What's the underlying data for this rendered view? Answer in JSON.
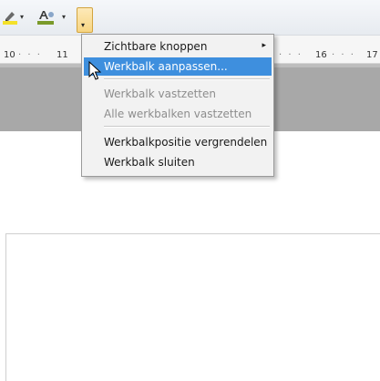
{
  "toolbar": {
    "icons": [
      "highlighter-icon",
      "font-color-icon"
    ],
    "dropdown_glyph": "▾"
  },
  "ruler": {
    "left_number": "10",
    "middle_number": "11",
    "right_number_a": "16",
    "right_number_b": "17",
    "dots": "· · ·"
  },
  "menu": {
    "items": [
      {
        "label": "Zichtbare knoppen",
        "has_submenu": true,
        "submenu_glyph": "▸",
        "state": "normal"
      },
      {
        "label": "Werkbalk aanpassen...",
        "has_submenu": false,
        "state": "highlighted"
      },
      {
        "label": "Werkbalk vastzetten",
        "has_submenu": false,
        "state": "disabled"
      },
      {
        "label": "Alle werkbalken vastzetten",
        "has_submenu": false,
        "state": "disabled"
      },
      {
        "label": "Werkbalkpositie vergrendelen",
        "has_submenu": false,
        "state": "normal"
      },
      {
        "label": "Werkbalk sluiten",
        "has_submenu": false,
        "state": "normal"
      }
    ]
  },
  "colors": {
    "highlight": "#3e8fde",
    "menu_bg": "#f2f2f2",
    "workspace_grey": "#a8a8a8"
  }
}
